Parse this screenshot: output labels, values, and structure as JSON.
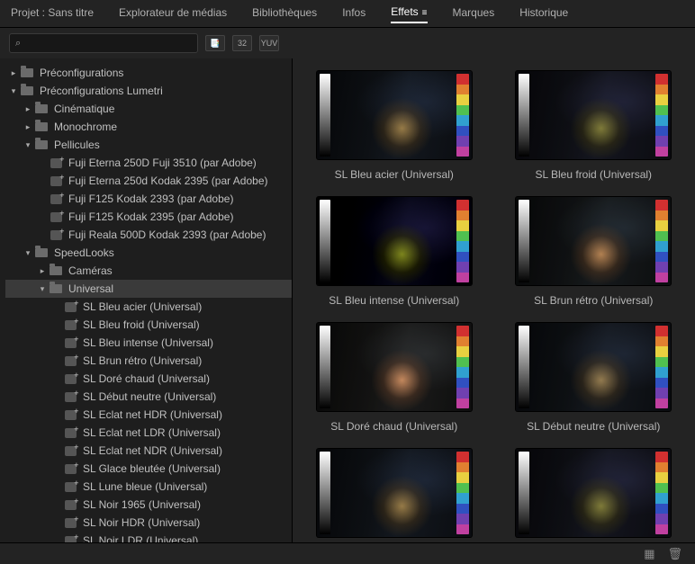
{
  "tabs": [
    {
      "label": "Projet : Sans titre",
      "active": false
    },
    {
      "label": "Explorateur de médias",
      "active": false
    },
    {
      "label": "Bibliothèques",
      "active": false
    },
    {
      "label": "Infos",
      "active": false
    },
    {
      "label": "Effets",
      "active": true
    },
    {
      "label": "Marques",
      "active": false
    },
    {
      "label": "Historique",
      "active": false
    }
  ],
  "search": {
    "value": "",
    "placeholder": ""
  },
  "toolbar_icons": [
    "fx-toggle",
    "thirtytwo",
    "yuv"
  ],
  "toolbar_labels": {
    "fx": "📑",
    "thirtytwo": "32",
    "yuv": "YUV"
  },
  "tree": [
    {
      "indent": 0,
      "chev": ">",
      "icon": "folder",
      "label": "Préconfigurations",
      "sel": false
    },
    {
      "indent": 0,
      "chev": "v",
      "icon": "folder",
      "label": "Préconfigurations Lumetri",
      "sel": false
    },
    {
      "indent": 1,
      "chev": ">",
      "icon": "folder",
      "label": "Cinématique",
      "sel": false
    },
    {
      "indent": 1,
      "chev": ">",
      "icon": "folder",
      "label": "Monochrome",
      "sel": false
    },
    {
      "indent": 1,
      "chev": "v",
      "icon": "folder",
      "label": "Pellicules",
      "sel": false
    },
    {
      "indent": 2,
      "chev": "",
      "icon": "preset",
      "label": "Fuji Eterna 250D Fuji 3510 (par Adobe)",
      "sel": false
    },
    {
      "indent": 2,
      "chev": "",
      "icon": "preset",
      "label": "Fuji Eterna 250d Kodak 2395 (par Adobe)",
      "sel": false
    },
    {
      "indent": 2,
      "chev": "",
      "icon": "preset",
      "label": "Fuji F125 Kodak 2393 (par Adobe)",
      "sel": false
    },
    {
      "indent": 2,
      "chev": "",
      "icon": "preset",
      "label": "Fuji F125 Kodak 2395 (par Adobe)",
      "sel": false
    },
    {
      "indent": 2,
      "chev": "",
      "icon": "preset",
      "label": "Fuji Reala 500D Kodak 2393 (par Adobe)",
      "sel": false
    },
    {
      "indent": 1,
      "chev": "v",
      "icon": "folder",
      "label": "SpeedLooks",
      "sel": false
    },
    {
      "indent": 2,
      "chev": ">",
      "icon": "folder",
      "label": "Caméras",
      "sel": false
    },
    {
      "indent": 2,
      "chev": "v",
      "icon": "folder",
      "label": "Universal",
      "sel": true
    },
    {
      "indent": 3,
      "chev": "",
      "icon": "preset",
      "label": "SL Bleu acier (Universal)",
      "sel": false
    },
    {
      "indent": 3,
      "chev": "",
      "icon": "preset",
      "label": "SL Bleu froid (Universal)",
      "sel": false
    },
    {
      "indent": 3,
      "chev": "",
      "icon": "preset",
      "label": "SL Bleu intense (Universal)",
      "sel": false
    },
    {
      "indent": 3,
      "chev": "",
      "icon": "preset",
      "label": "SL Brun rétro (Universal)",
      "sel": false
    },
    {
      "indent": 3,
      "chev": "",
      "icon": "preset",
      "label": "SL Doré chaud (Universal)",
      "sel": false
    },
    {
      "indent": 3,
      "chev": "",
      "icon": "preset",
      "label": "SL Début neutre (Universal)",
      "sel": false
    },
    {
      "indent": 3,
      "chev": "",
      "icon": "preset",
      "label": "SL Eclat net HDR (Universal)",
      "sel": false
    },
    {
      "indent": 3,
      "chev": "",
      "icon": "preset",
      "label": "SL Eclat net LDR (Universal)",
      "sel": false
    },
    {
      "indent": 3,
      "chev": "",
      "icon": "preset",
      "label": "SL Eclat net NDR (Universal)",
      "sel": false
    },
    {
      "indent": 3,
      "chev": "",
      "icon": "preset",
      "label": "SL Glace bleutée (Universal)",
      "sel": false
    },
    {
      "indent": 3,
      "chev": "",
      "icon": "preset",
      "label": "SL Lune bleue (Universal)",
      "sel": false
    },
    {
      "indent": 3,
      "chev": "",
      "icon": "preset",
      "label": "SL Noir 1965 (Universal)",
      "sel": false
    },
    {
      "indent": 3,
      "chev": "",
      "icon": "preset",
      "label": "SL Noir HDR (Universal)",
      "sel": false
    },
    {
      "indent": 3,
      "chev": "",
      "icon": "preset",
      "label": "SL Noir LDR (Universal)",
      "sel": false
    }
  ],
  "grid": [
    {
      "label": "SL Bleu acier (Universal)",
      "tone": ""
    },
    {
      "label": "SL Bleu froid (Universal)",
      "tone": "cold"
    },
    {
      "label": "SL Bleu intense (Universal)",
      "tone": "intense"
    },
    {
      "label": "SL Brun rétro (Universal)",
      "tone": "warm"
    },
    {
      "label": "SL Doré chaud (Universal)",
      "tone": "gold"
    },
    {
      "label": "SL Début neutre (Universal)",
      "tone": "neutral"
    },
    {
      "label": "",
      "tone": ""
    },
    {
      "label": "",
      "tone": "cold"
    }
  ],
  "hues": [
    "#d13030",
    "#e08030",
    "#e8d040",
    "#50c050",
    "#30a0d0",
    "#3050c0",
    "#7040b0",
    "#c040a0"
  ]
}
